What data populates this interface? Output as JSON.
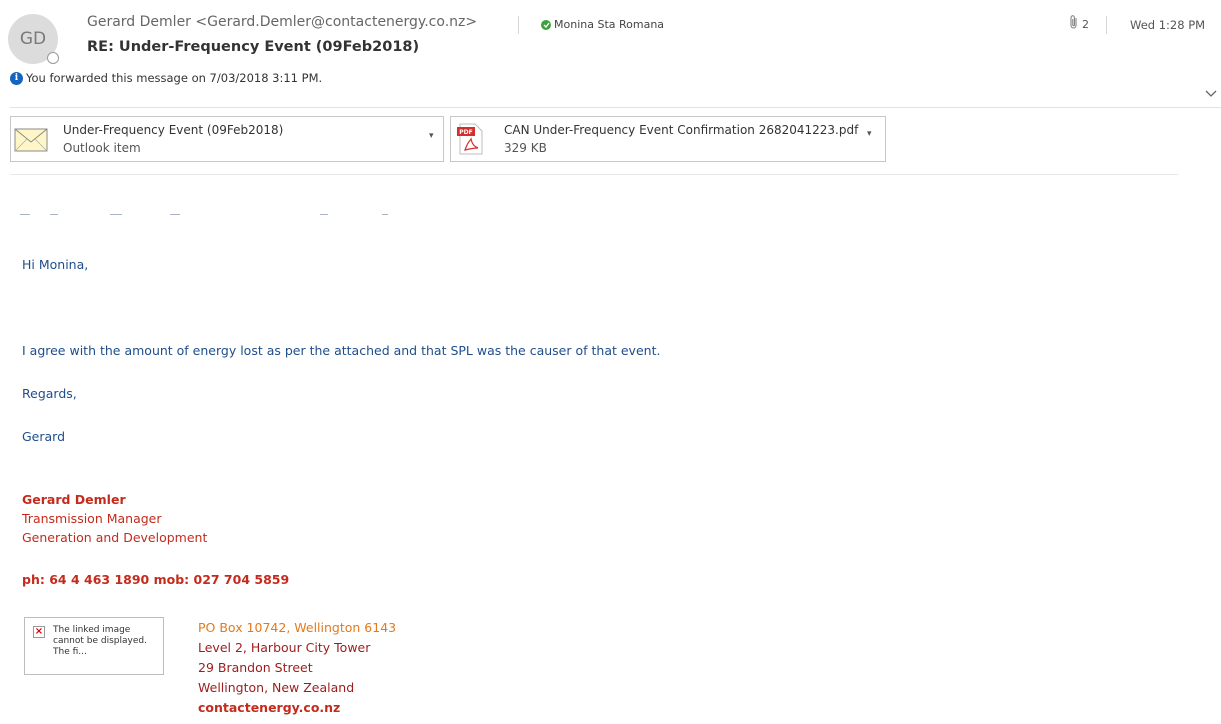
{
  "header": {
    "avatar_initials": "GD",
    "from": "Gerard Demler <Gerard.Demler@contactenergy.co.nz>",
    "recipient": "Monina Sta Romana",
    "subject": "RE: Under-Frequency Event (09Feb2018)",
    "forward_notice": "You forwarded this message on 7/03/2018 3:11 PM.",
    "attachment_count": "2",
    "date": "Wed 1:28 PM"
  },
  "attachments": [
    {
      "name": "Under-Frequency Event (09Feb2018)",
      "meta": "Outlook item",
      "icon": "envelope-icon"
    },
    {
      "name": "CAN Under-Frequency Event Confirmation 2682041223.pdf",
      "meta": "329 KB",
      "icon": "pdf-icon"
    }
  ],
  "body": {
    "greeting": "Hi Monina,",
    "paragraph": "I agree with the amount of energy lost as per the attached and that SPL was the causer of that event.",
    "closing": "Regards,",
    "sign": "Gerard"
  },
  "signature": {
    "name": "Gerard Demler",
    "title": "Transmission Manager",
    "department": "Generation and Development",
    "phones": "ph: 64 4 463 1890 mob: 027 704 5859",
    "broken_image_text": "The linked image cannot be displayed.  The fi...",
    "po_box": "PO Box 10742, Wellington 6143",
    "address_line1": "Level 2, Harbour City Tower",
    "address_line2": "29 Brandon Street",
    "address_line3": "Wellington, New Zealand",
    "website": "contactenergy.co.nz"
  },
  "colors": {
    "body_text": "#1f4e8c",
    "signature_red": "#c42b1c",
    "signature_orange": "#e37a1e",
    "presence_green": "#3aa33a",
    "info_blue": "#1565c0"
  }
}
